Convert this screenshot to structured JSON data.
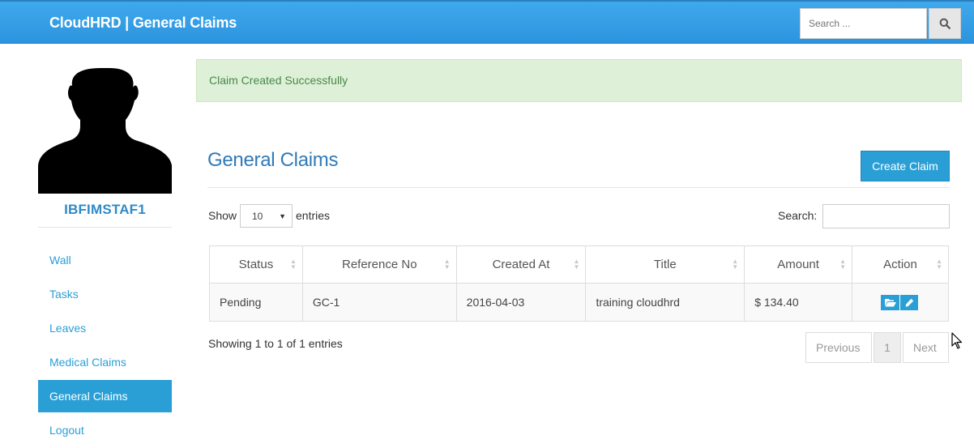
{
  "navbar": {
    "brand": "CloudHRD | General Claims",
    "search_placeholder": "Search ..."
  },
  "sidebar": {
    "username": "IBFIMSTAF1",
    "items": [
      {
        "label": "Wall",
        "active": false
      },
      {
        "label": "Tasks",
        "active": false
      },
      {
        "label": "Leaves",
        "active": false
      },
      {
        "label": "Medical Claims",
        "active": false
      },
      {
        "label": "General Claims",
        "active": true
      },
      {
        "label": "Logout",
        "active": false
      }
    ]
  },
  "alert": {
    "message": "Claim Created Successfully"
  },
  "main": {
    "title": "General Claims",
    "create_label": "Create Claim",
    "show_label": "Show",
    "entries_value": "10",
    "entries_label": "entries",
    "search_label": "Search:",
    "columns": [
      "Status",
      "Reference No",
      "Created At",
      "Title",
      "Amount",
      "Action"
    ],
    "rows": [
      {
        "status": "Pending",
        "reference": "GC-1",
        "created_at": "2016-04-03",
        "title": "training cloudhrd",
        "amount": "$ 134.40"
      }
    ],
    "showing_text": "Showing 1 to 1 of 1 entries",
    "pager": {
      "previous": "Previous",
      "page": "1",
      "next": "Next"
    }
  },
  "colors": {
    "primary": "#2a9fd6",
    "alert_bg": "#dff0d8",
    "alert_text": "#468847",
    "title": "#2f7ab8"
  },
  "icons": {
    "search": "search-icon",
    "view": "folder-open-icon",
    "edit": "pencil-icon"
  }
}
